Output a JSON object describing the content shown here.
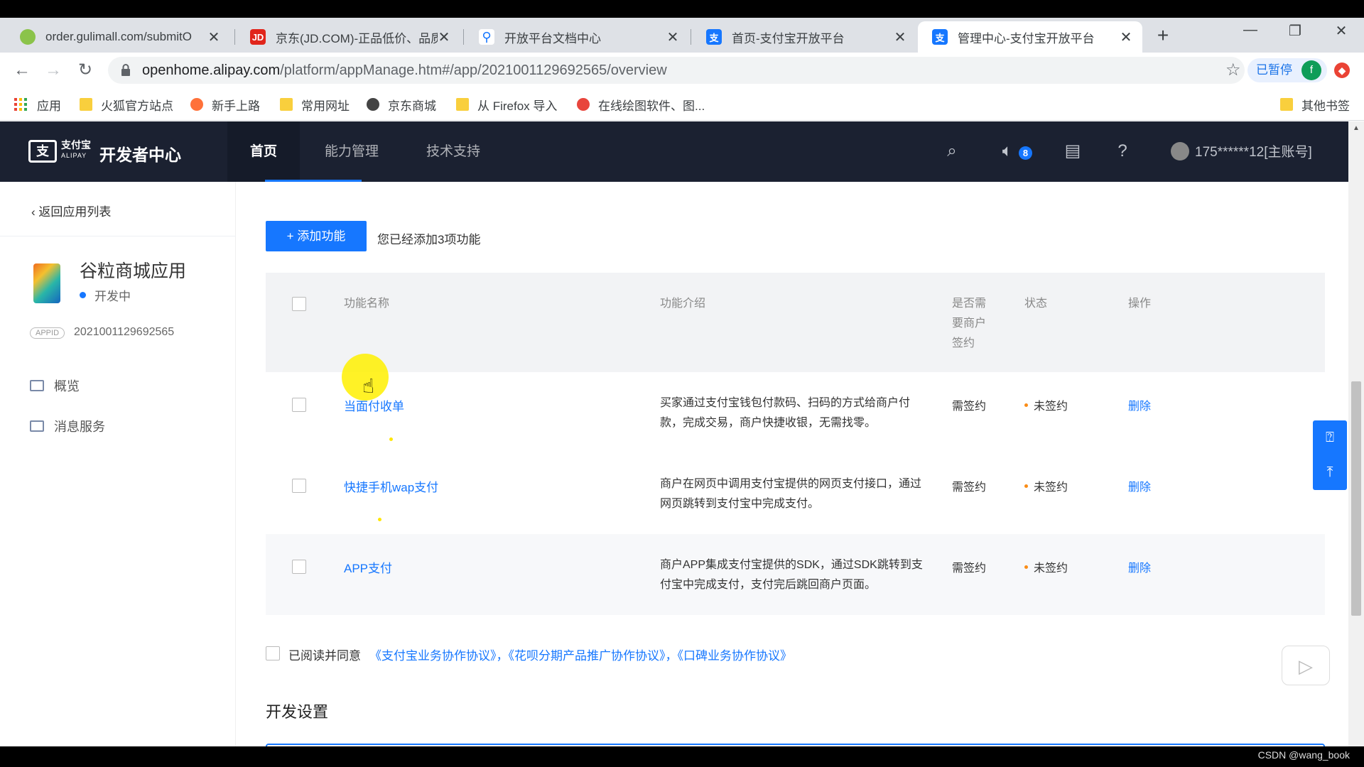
{
  "browser": {
    "tabs": [
      {
        "title": "order.gulimall.com/submitO",
        "active": false
      },
      {
        "title": "京东(JD.COM)-正品低价、品质",
        "active": false
      },
      {
        "title": "开放平台文档中心",
        "active": false
      },
      {
        "title": "首页-支付宝开放平台",
        "active": false
      },
      {
        "title": "管理中心-支付宝开放平台",
        "active": true
      }
    ],
    "url_host": "openhome.alipay.com",
    "url_path": "/platform/appManage.htm#/app/2021001129692565/overview",
    "paused_label": "已暂停",
    "profile_initial": "f",
    "bookmarks": [
      "应用",
      "火狐官方站点",
      "新手上路",
      "常用网址",
      "京东商城",
      "从 Firefox 导入",
      "在线绘图软件、图...",
      "其他书签"
    ]
  },
  "header": {
    "logo_cn": "支付宝",
    "logo_en": "ALIPAY",
    "title": "开发者中心",
    "nav": [
      "首页",
      "能力管理",
      "技术支持"
    ],
    "notification_count": "8",
    "account": "175******12[主账号]"
  },
  "sidebar": {
    "back_label": "返回应用列表",
    "app_name": "谷粒商城应用",
    "app_status": "开发中",
    "appid_tag": "APPID",
    "appid": "2021001129692565",
    "menu": [
      "概览",
      "消息服务"
    ]
  },
  "main": {
    "add_button": "+ 添加功能",
    "added_text": "您已经添加3项功能",
    "columns": [
      "功能名称",
      "功能介绍",
      "是否需要商户签约",
      "状态",
      "操作"
    ],
    "rows": [
      {
        "name": "当面付收单",
        "desc": "买家通过支付宝钱包付款码、扫码的方式给商户付款，完成交易，商户快捷收银，无需找零。",
        "sign": "需签约",
        "status": "未签约",
        "action": "删除"
      },
      {
        "name": "快捷手机wap支付",
        "desc": "商户在网页中调用支付宝提供的网页支付接口，通过网页跳转到支付宝中完成支付。",
        "sign": "需签约",
        "status": "未签约",
        "action": "删除"
      },
      {
        "name": "APP支付",
        "desc": "商户APP集成支付宝提供的SDK，通过SDK跳转到支付宝中完成支付，支付完后跳回商户页面。",
        "sign": "需签约",
        "status": "未签约",
        "action": "删除"
      }
    ],
    "agree_text": "已阅读并同意",
    "agree_links": "《支付宝业务协作协议》，《花呗分期产品推广协作协议》，《口碑业务协作协议》",
    "dev_settings_title": "开发设置"
  },
  "watermark": "CSDN @wang_book",
  "colors": {
    "brand": "#1677ff",
    "header_bg": "#1b2131",
    "status_dot": "#fa8c16"
  }
}
